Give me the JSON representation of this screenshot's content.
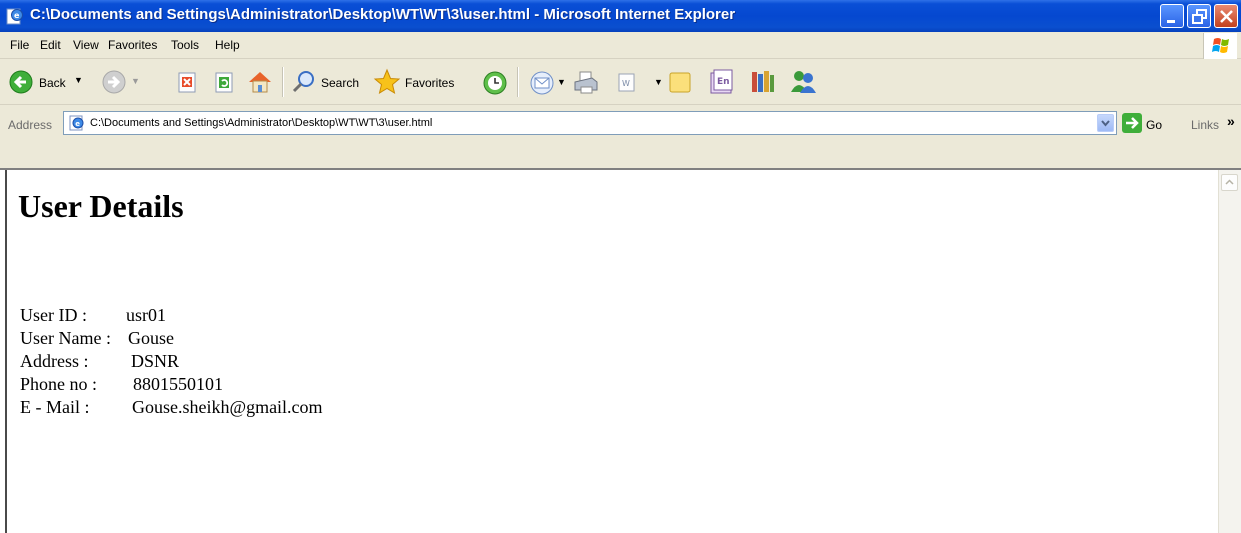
{
  "window": {
    "title": "C:\\Documents and Settings\\Administrator\\Desktop\\WT\\WT\\3\\user.html - Microsoft Internet Explorer"
  },
  "menu": [
    "File",
    "Edit",
    "View",
    "Favorites",
    "Tools",
    "Help"
  ],
  "toolbar": {
    "back_label": "Back",
    "search_label": "Search",
    "favorites_label": "Favorites"
  },
  "address": {
    "label": "Address",
    "value": "C:\\Documents and Settings\\Administrator\\Desktop\\WT\\WT\\3\\user.html",
    "go_label": "Go",
    "links_label": "Links"
  },
  "page": {
    "heading": "User Details",
    "fields": [
      {
        "label": "User ID :",
        "value": "usr01"
      },
      {
        "label": "User Name :",
        "value": "Gouse"
      },
      {
        "label": "Address :",
        "value": "DSNR"
      },
      {
        "label": "Phone no :",
        "value": "8801550101"
      },
      {
        "label": "E - Mail :",
        "value": "Gouse.sheikh@gmail.com"
      }
    ]
  },
  "colors": {
    "titlebar": "#0548d0",
    "chrome": "#ece9d8",
    "close_button": "#c2401d"
  }
}
